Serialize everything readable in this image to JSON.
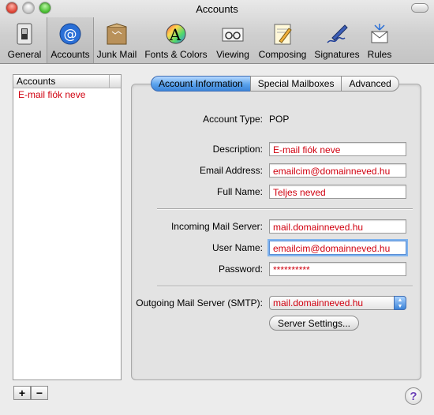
{
  "window": {
    "title": "Accounts"
  },
  "toolbar": {
    "items": [
      {
        "label": "General",
        "icon": "switch-icon"
      },
      {
        "label": "Accounts",
        "icon": "at-sign-icon"
      },
      {
        "label": "Junk Mail",
        "icon": "junk-mail-icon"
      },
      {
        "label": "Fonts & Colors",
        "icon": "fonts-colors-icon"
      },
      {
        "label": "Viewing",
        "icon": "viewing-glasses-icon"
      },
      {
        "label": "Composing",
        "icon": "composing-pencil-icon"
      },
      {
        "label": "Signatures",
        "icon": "signature-pen-icon"
      },
      {
        "label": "Rules",
        "icon": "rules-envelope-icon"
      }
    ],
    "selected": "Accounts"
  },
  "accounts": {
    "header": "Accounts",
    "items": [
      "E-mail fiók neve"
    ],
    "add_label": "+",
    "remove_label": "−"
  },
  "tabs": {
    "items": [
      "Account Information",
      "Special Mailboxes",
      "Advanced"
    ],
    "active": "Account Information"
  },
  "form": {
    "account_type_label": "Account Type:",
    "account_type_value": "POP",
    "description_label": "Description:",
    "description_value": "E-mail fiók neve",
    "email_label": "Email Address:",
    "email_value": "emailcim@domainneved.hu",
    "full_name_label": "Full Name:",
    "full_name_value": "Teljes neved",
    "incoming_label": "Incoming Mail Server:",
    "incoming_value": "mail.domainneved.hu",
    "user_label": "User Name:",
    "user_value": "emailcim@domainneved.hu",
    "password_label": "Password:",
    "password_value": "**********",
    "smtp_label": "Outgoing Mail Server (SMTP):",
    "smtp_value": "mail.domainneved.hu",
    "server_settings_label": "Server Settings..."
  },
  "help_label": "?",
  "colors": {
    "highlight_text": "#d0000f",
    "tab_active": "#3c84d8"
  }
}
